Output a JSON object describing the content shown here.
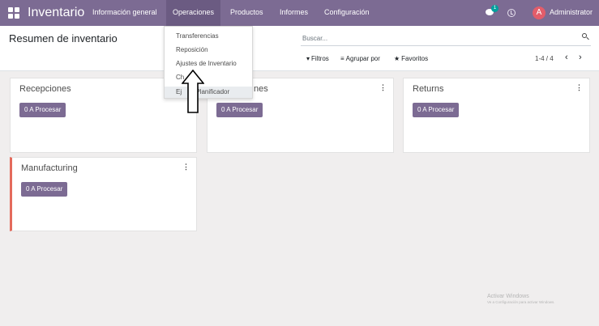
{
  "navbar": {
    "brand": "Inventario",
    "menu": [
      {
        "label": "Información general",
        "active": false
      },
      {
        "label": "Operaciones",
        "active": true
      },
      {
        "label": "Productos",
        "active": false
      },
      {
        "label": "Informes",
        "active": false
      },
      {
        "label": "Configuración",
        "active": false
      }
    ],
    "chat_badge": "1",
    "user_initial": "A",
    "user_name": "Administrator",
    "colors": {
      "bar": "#7c6b93",
      "avatar": "#e35d6a",
      "badge": "#00a09d"
    }
  },
  "control_panel": {
    "title": "Resumen de inventario",
    "search_placeholder": "Buscar...",
    "filters_label": "Filtros",
    "group_by_label": "Agrupar por",
    "favorites_label": "Favoritos",
    "pager_value": "1-4 / 4",
    "pager_prev": "‹",
    "pager_next": "›"
  },
  "operations_menu": {
    "items": [
      "Transferencias",
      "Reposición",
      "Ajustes de Inventario",
      "Ch",
      "Ej",
      "Planificador"
    ],
    "hovered_item_index": 4
  },
  "cards": [
    {
      "title": "Recepciones",
      "button": "0 A Procesar"
    },
    {
      "title": "nes",
      "button": "0 A Procesar"
    },
    {
      "title": "Returns",
      "button": "0 A Procesar"
    },
    {
      "title": "Manufacturing",
      "button": "0 A Procesar",
      "accent": "#e46a5c"
    }
  ],
  "watermark": {
    "title": "Activar Windows",
    "subtitle": "Ve a Configuración para activar Windows."
  }
}
